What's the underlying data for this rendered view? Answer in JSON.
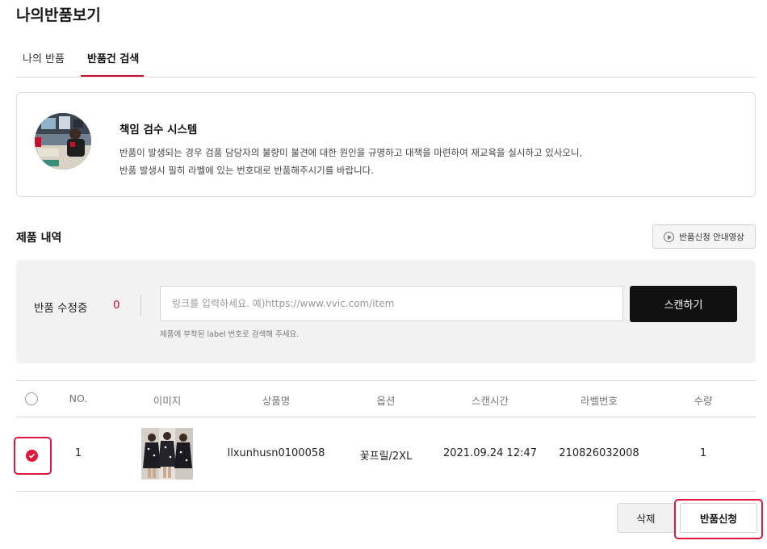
{
  "page": {
    "title": "나의반품보기"
  },
  "tabs": [
    {
      "label": "나의 반품",
      "active": false
    },
    {
      "label": "반품건 검색",
      "active": true
    }
  ],
  "info": {
    "title": "책임 검수 시스템",
    "line1": "반품이 발생되는 경우 검품 담당자의 불량미 불견에 대한 원인을 규명하고 대책을 마련하여 재교육을 실시하고 있사오니,",
    "line2": "반품 발생시 필히 라벨에 있는 번호대로 반품해주시기를 바랍니다."
  },
  "products": {
    "title": "제품 내역",
    "guide_button": "반품신청 안내영상"
  },
  "scan": {
    "label": "반품 수정중",
    "count": "0",
    "placeholder": "링크를 입력하세요. 예)https://www.vvic.com/item",
    "button": "스캔하기",
    "hint": "제품에 부착된 label 번호로 검색해 주세요."
  },
  "table": {
    "headers": [
      "NO.",
      "이미지",
      "상품명",
      "옵션",
      "스캔시간",
      "라벨번호",
      "수량"
    ],
    "rows": [
      {
        "checked": true,
        "no": "1",
        "name": "llxunhusn0100058",
        "option": "꽃프릴/2XL",
        "scan_time": "2021.09.24 12:47",
        "label_no": "210826032008",
        "qty": "1"
      }
    ]
  },
  "actions": {
    "delete": "삭제",
    "submit": "반품신청"
  },
  "colors": {
    "accent": "#e0173c",
    "dark_button": "#111111",
    "panel_bg": "#f2f2f2"
  }
}
